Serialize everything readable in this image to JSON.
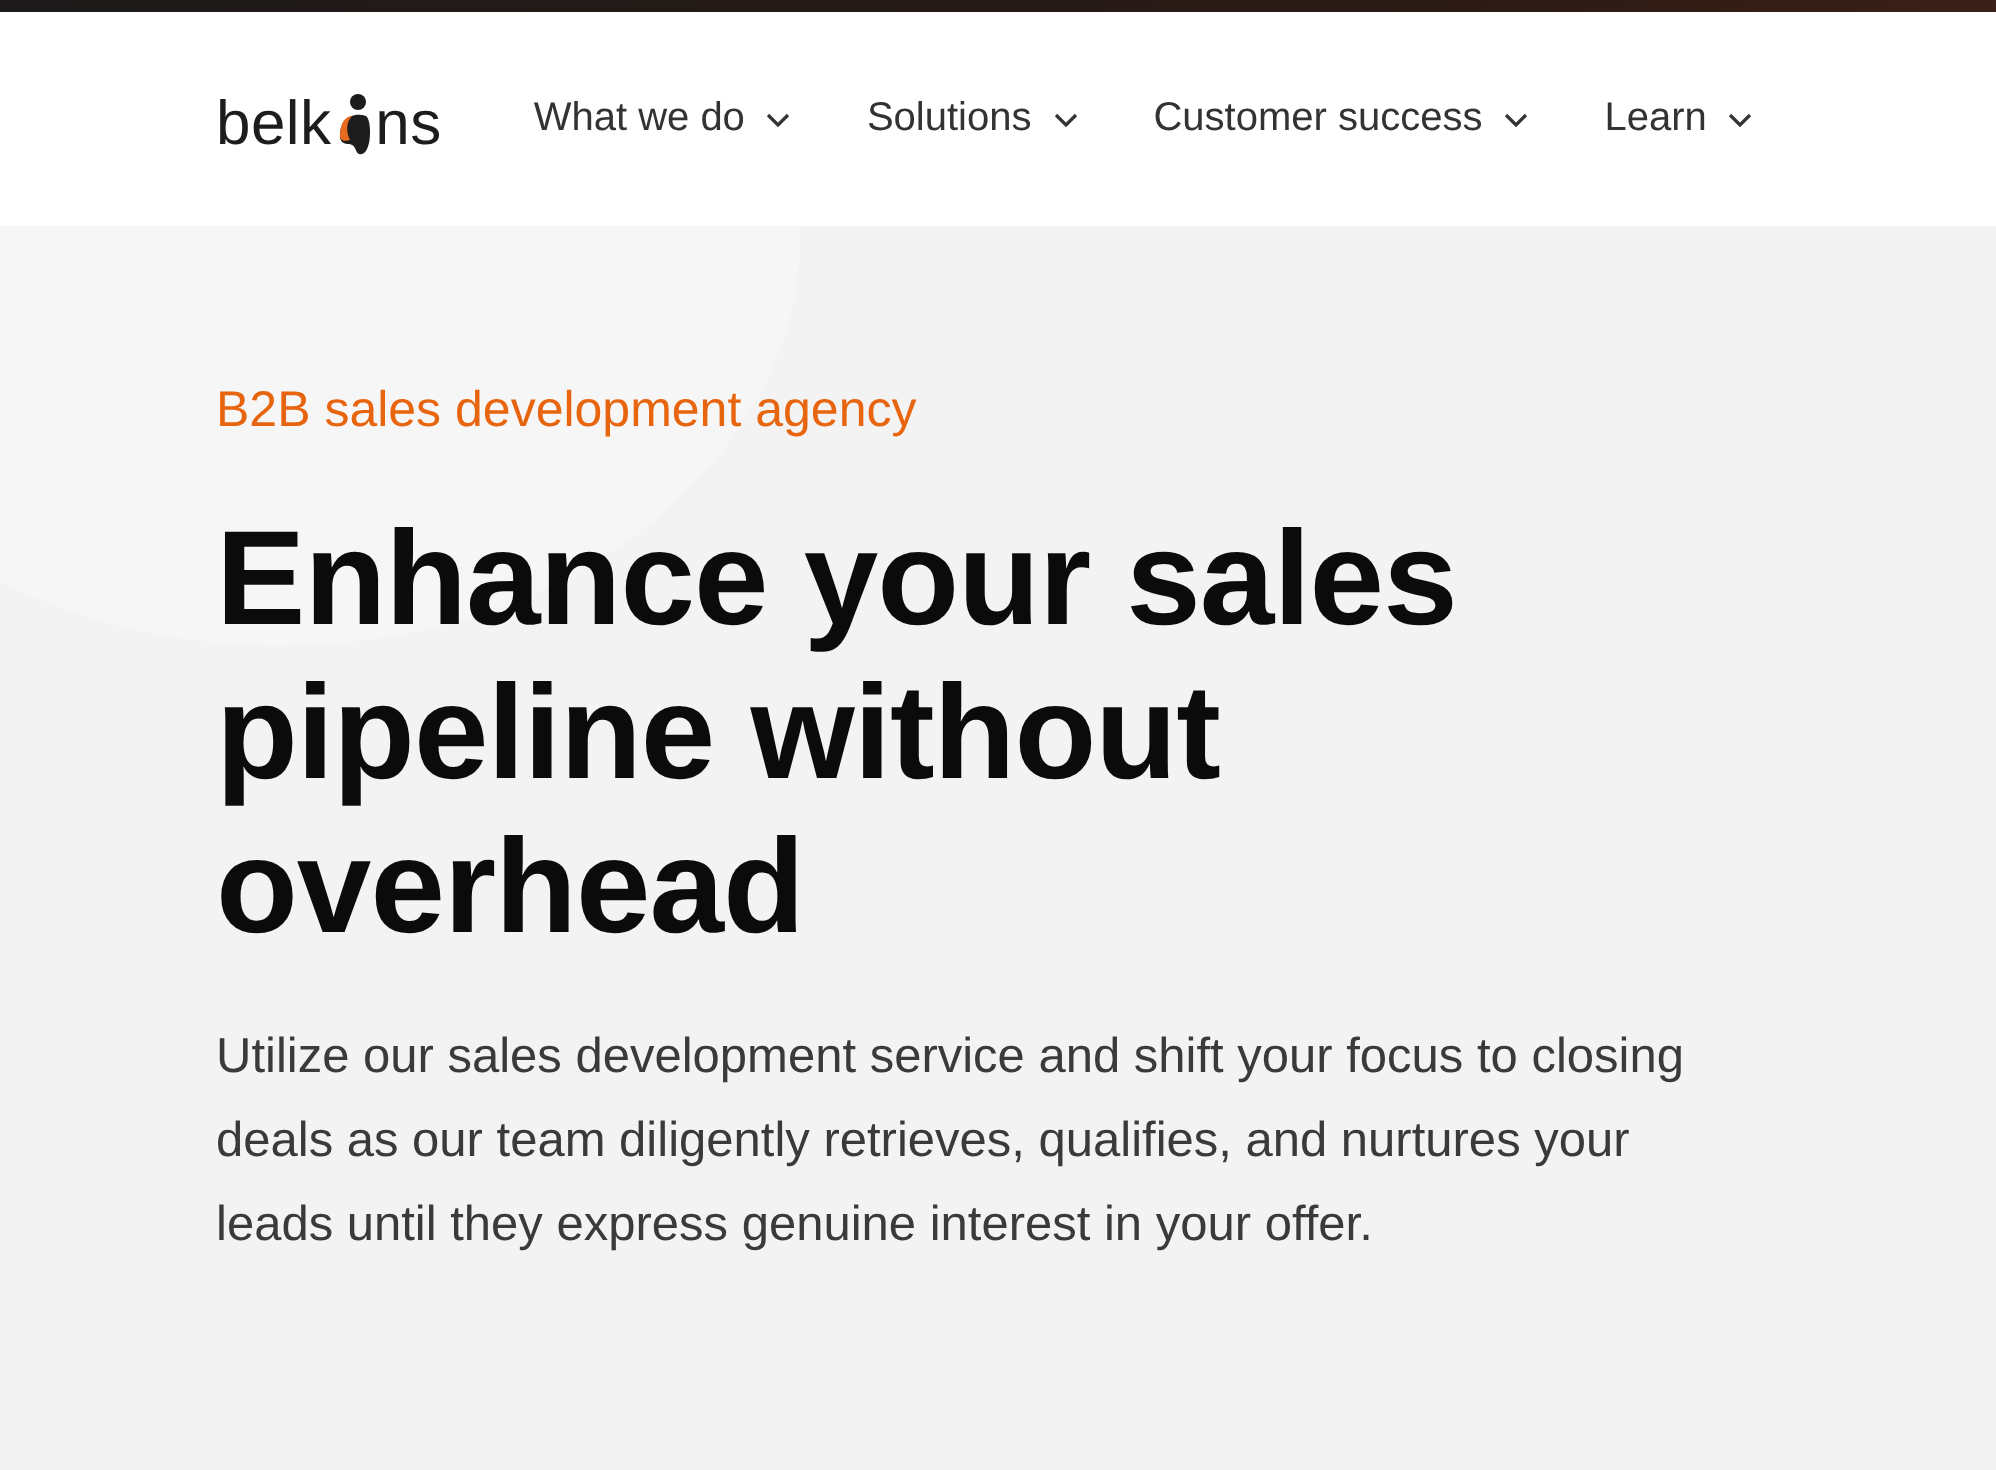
{
  "header": {
    "logo": {
      "before": "belk",
      "after": "ns"
    },
    "nav": [
      {
        "label": "What we do",
        "has_menu": true
      },
      {
        "label": "Solutions",
        "has_menu": true
      },
      {
        "label": "Customer success",
        "has_menu": true
      },
      {
        "label": "Learn",
        "has_menu": true
      }
    ]
  },
  "hero": {
    "eyebrow": "B2B sales development agency",
    "title": "Enhance your sales pipeline without overhead",
    "description": "Utilize our sales development service and shift your focus to closing deals as our team diligently retrieves, qualifies, and nurtures your leads until they express genuine interest in your offer."
  }
}
